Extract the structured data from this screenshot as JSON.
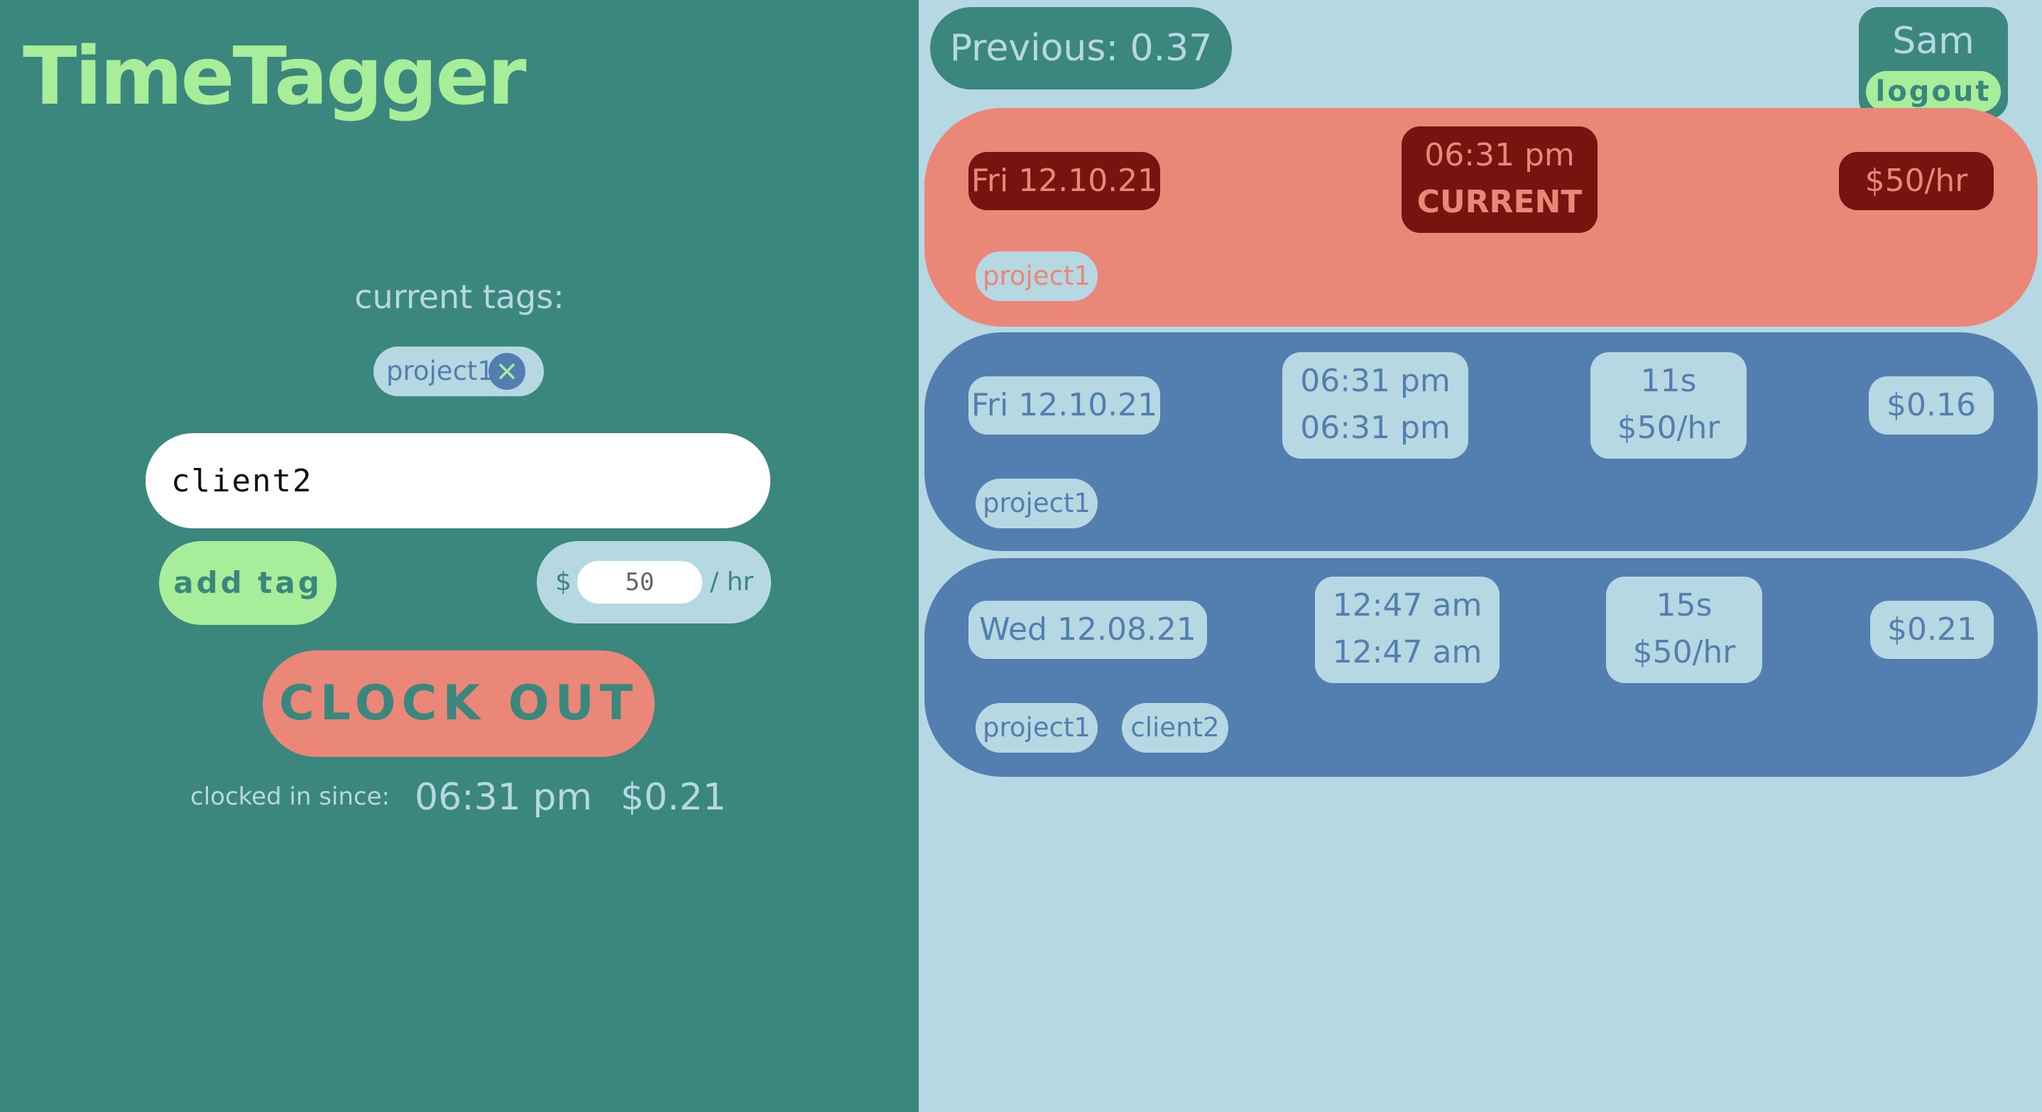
{
  "app": {
    "title": "TimeTagger"
  },
  "tracker": {
    "tags_heading": "current tags:",
    "current_tags": [
      "project1"
    ],
    "tag_input_value": "client2",
    "add_tag_label": "add tag",
    "rate_currency": "$",
    "rate_placeholder": "50",
    "rate_unit": "/ hr",
    "clock_button_label": "CLOCK OUT",
    "clocked_in_label": "clocked in since:",
    "clocked_in_time": "06:31 pm",
    "clocked_in_cost": "$0.21"
  },
  "header": {
    "previous_label": "Previous: 0.37",
    "user_name": "Sam",
    "logout_label": "logout"
  },
  "entries": [
    {
      "date": "Fri 12.10.21",
      "start": "06:31 pm",
      "status": "CURRENT",
      "rate": "$50/hr",
      "tags": [
        "project1"
      ]
    },
    {
      "date": "Fri 12.10.21",
      "start": "06:31 pm",
      "end": "06:31 pm",
      "duration": "11s",
      "rate": "$50/hr",
      "cost": "$0.16",
      "tags": [
        "project1"
      ]
    },
    {
      "date": "Wed 12.08.21",
      "start": "12:47 am",
      "end": "12:47 am",
      "duration": "15s",
      "rate": "$50/hr",
      "cost": "$0.21",
      "tags": [
        "project1",
        "client2"
      ]
    }
  ],
  "colors": {
    "panel_green": "#3b877d",
    "light_green": "#a8ee9a",
    "light_blue": "#b6d8e2",
    "salmon": "#eb8778",
    "blue": "#537fb0",
    "dark_red": "#781410"
  }
}
